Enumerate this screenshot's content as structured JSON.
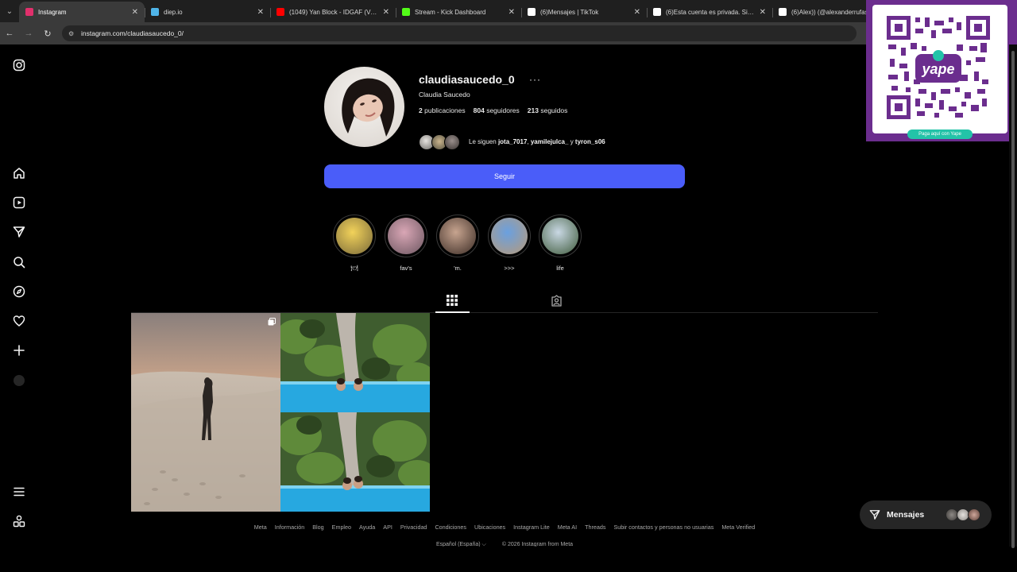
{
  "browser": {
    "tabs": [
      {
        "title": "Instagram",
        "color": "#e1306c",
        "active": true
      },
      {
        "title": "diep.io",
        "color": "#4fb4e8",
        "active": false
      },
      {
        "title": "(1049) Yan Block - IDGAF (Video...",
        "color": "#ff0000",
        "active": false
      },
      {
        "title": "Stream - Kick Dashboard",
        "color": "#53fc18",
        "active": false
      },
      {
        "title": "(6)Mensajes | TikTok",
        "color": "#ffffff",
        "active": false
      },
      {
        "title": "(6)Esta cuenta es privada. Sigue...",
        "color": "#ffffff",
        "active": false
      },
      {
        "title": "(6)Alex)) (@alexanderrufas",
        "color": "#ffffff",
        "active": false
      }
    ],
    "url": "instagram.com/claudiasaucedo_0/"
  },
  "overlay": {
    "yape_pill": "Paga aquí con Yape",
    "yape_center": "yape"
  },
  "profile": {
    "username": "claudiasaucedo_0",
    "more": "···",
    "fullname": "Claudia Saucedo",
    "posts_count": "2",
    "posts_label": "publicaciones",
    "followers_count": "804",
    "followers_label": "seguidores",
    "following_count": "213",
    "following_label": "seguidos",
    "mutual_prefix": "Le siguen",
    "mutual_1": "jota_7017",
    "mutual_2": "yamilejulca_",
    "mutual_join": "y",
    "mutual_3": "tyron_s06",
    "follow_label": "Seguir"
  },
  "highlights": [
    {
      "label": "🍽",
      "c1": "#f2d25a",
      "c2": "#7a6a3a"
    },
    {
      "label": "fav's",
      "c1": "#d9a6b5",
      "c2": "#6b5660"
    },
    {
      "label": "'m.",
      "c1": "#c7a48f",
      "c2": "#3a2b25"
    },
    {
      "label": ">>>",
      "c1": "#6aa0e0",
      "c2": "#b89a78"
    },
    {
      "label": "life",
      "c1": "#c9d8e4",
      "c2": "#3e5a3a"
    }
  ],
  "footer": {
    "links": [
      "Meta",
      "Información",
      "Blog",
      "Empleo",
      "Ayuda",
      "API",
      "Privacidad",
      "Condiciones",
      "Ubicaciones",
      "Instagram Lite",
      "Meta AI",
      "Threads",
      "Subir contactos y personas no usuarias",
      "Meta Verified"
    ],
    "language": "Español (España) ⌵",
    "copyright": "© 2026 Instagram from Meta"
  },
  "messages": {
    "label": "Mensajes"
  }
}
